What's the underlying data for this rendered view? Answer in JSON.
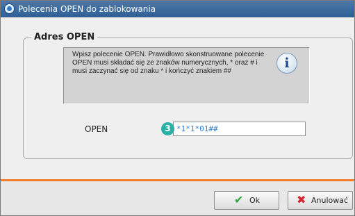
{
  "window": {
    "title": "Polecenia OPEN do zablokowania"
  },
  "group": {
    "legend": "Adres OPEN",
    "info_text": "Wpisz polecenie OPEN. Prawidłowo skonstruowane polecenie OPEN musi składać się ze znaków numerycznych, * oraz # i musi zaczynać się od znaku * i kończyć znakiem ##",
    "info_icon": "info-icon",
    "open_label": "OPEN",
    "open_value": "*1*1*01##",
    "callout_number": "3"
  },
  "buttons": {
    "ok_label": "Ok",
    "cancel_label": "Anulować"
  },
  "colors": {
    "titlebar": "#3a689c",
    "accent_separator": "#f57e2a",
    "callout": "#2bb0a6",
    "input_text": "#3a7fd0"
  }
}
